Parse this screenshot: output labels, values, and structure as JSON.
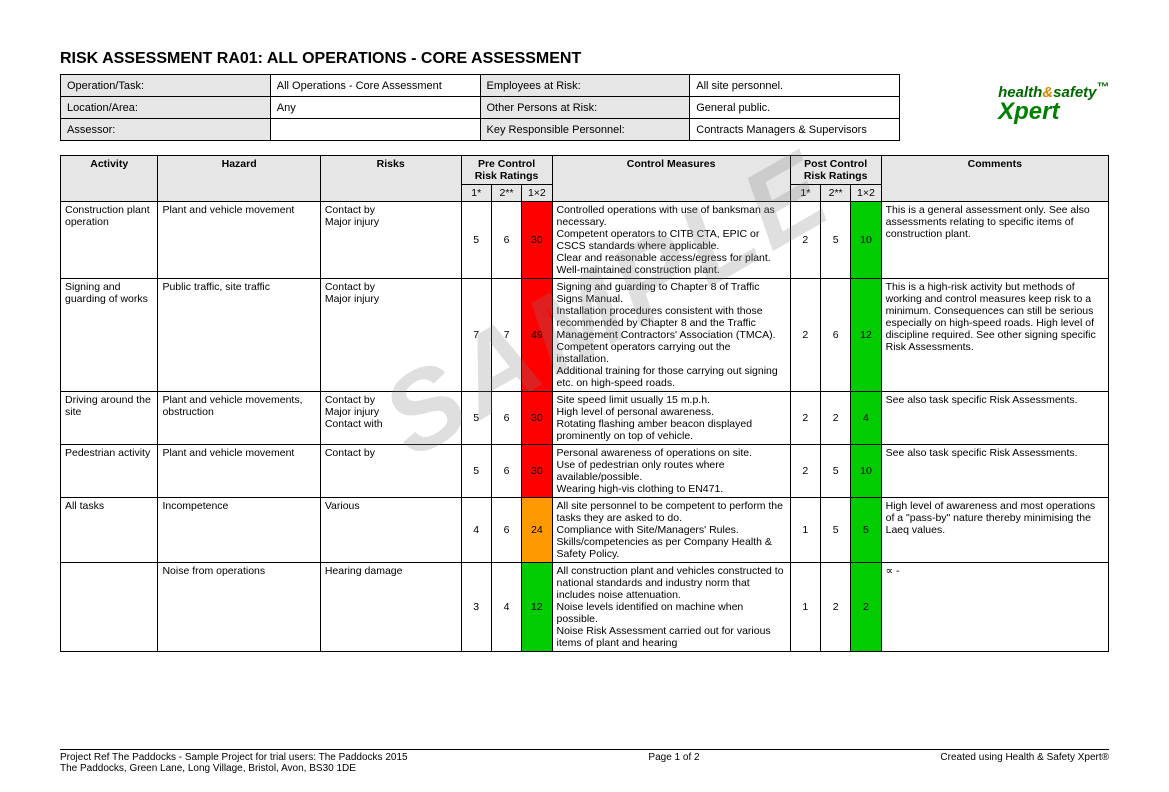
{
  "title": "RISK ASSESSMENT RA01: ALL OPERATIONS - CORE ASSESSMENT",
  "meta": {
    "operation_label": "Operation/Task:",
    "operation_val": "All Operations - Core Assessment",
    "employees_label": "Employees at Risk:",
    "employees_val": "All site personnel.",
    "location_label": "Location/Area:",
    "location_val": "Any",
    "others_label": "Other Persons at Risk:",
    "others_val": "General public.",
    "assessor_label": "Assessor:",
    "assessor_val": "",
    "key_label": "Key Responsible Personnel:",
    "key_val": "Contracts Managers & Supervisors"
  },
  "logo": {
    "top1": "health",
    "amp": "&",
    "top2": "safety",
    "bot": "Xpert"
  },
  "watermark": "SAMPLE",
  "headers": {
    "activity": "Activity",
    "hazard": "Hazard",
    "risks": "Risks",
    "pre": "Pre Control Risk Ratings",
    "post": "Post Control Risk Ratings",
    "cm": "Control Measures",
    "comments": "Comments",
    "c1": "1*",
    "c2": "2**",
    "c3": "1×2"
  },
  "rows": [
    {
      "activity": "Construction plant operation",
      "hazard": "Plant and vehicle movement",
      "risks": "Contact by\nMajor injury",
      "pre": {
        "p": "5",
        "s": "6",
        "r": "30",
        "cls": "risk-red"
      },
      "cm": "Controlled operations with use of banksman as necessary.\nCompetent operators to CITB CTA, EPIC or CSCS standards where applicable.\nClear and reasonable access/egress for plant.\nWell-maintained construction plant.",
      "post": {
        "p": "2",
        "s": "5",
        "r": "10",
        "cls": "risk-green"
      },
      "comments": "This is a general assessment only. See also assessments relating to specific items of construction plant."
    },
    {
      "activity": "Signing and guarding of works",
      "hazard": "Public traffic, site traffic",
      "risks": "Contact by\nMajor injury",
      "pre": {
        "p": "7",
        "s": "7",
        "r": "49",
        "cls": "risk-red"
      },
      "cm": "Signing and guarding to Chapter 8 of Traffic Signs Manual.\nInstallation procedures consistent with those recommended by Chapter 8 and the Traffic Management Contractors' Association (TMCA).\nCompetent operators carrying out the installation.\nAdditional training for those carrying out signing etc. on high-speed roads.",
      "post": {
        "p": "2",
        "s": "6",
        "r": "12",
        "cls": "risk-green"
      },
      "comments": "This is a high-risk activity but methods of working and control measures keep risk to a minimum. Consequences can still be serious especially on high-speed roads. High level of discipline required. See other signing specific Risk Assessments."
    },
    {
      "activity": "Driving around the site",
      "hazard": "Plant and vehicle movements, obstruction",
      "risks": "Contact by\nMajor injury\nContact with",
      "pre": {
        "p": "5",
        "s": "6",
        "r": "30",
        "cls": "risk-red"
      },
      "cm": "Site speed limit usually 15 m.p.h.\nHigh level of personal awareness.\nRotating flashing amber beacon displayed prominently on top of vehicle.",
      "post": {
        "p": "2",
        "s": "2",
        "r": "4",
        "cls": "risk-green"
      },
      "comments": "See also task specific Risk Assessments."
    },
    {
      "activity": "Pedestrian activity",
      "hazard": "Plant and vehicle movement",
      "risks": "Contact by",
      "pre": {
        "p": "5",
        "s": "6",
        "r": "30",
        "cls": "risk-red"
      },
      "cm": "Personal awareness of operations on site.\nUse of pedestrian only routes where available/possible.\nWearing high-vis clothing to EN471.",
      "post": {
        "p": "2",
        "s": "5",
        "r": "10",
        "cls": "risk-green"
      },
      "comments": "See also task specific Risk Assessments."
    },
    {
      "activity": "All tasks",
      "hazard": "Incompetence",
      "risks": "Various",
      "pre": {
        "p": "4",
        "s": "6",
        "r": "24",
        "cls": "risk-orange"
      },
      "cm": "All site personnel to be competent to perform the tasks they are asked to do.\nCompliance with Site/Managers' Rules.\nSkills/competencies as per Company Health & Safety Policy.",
      "post": {
        "p": "1",
        "s": "5",
        "r": "5",
        "cls": "risk-green"
      },
      "comments": "High level of awareness and most operations of a \"pass-by\" nature thereby minimising the Laeq values."
    },
    {
      "activity": "",
      "hazard": "Noise from operations",
      "risks": "Hearing damage",
      "pre": {
        "p": "3",
        "s": "4",
        "r": "12",
        "cls": "risk-green"
      },
      "cm": "All construction plant and vehicles constructed to national standards and industry norm that includes noise attenuation.\nNoise levels identified on machine when possible.\nNoise Risk Assessment carried out for various items of plant and hearing",
      "post": {
        "p": "1",
        "s": "2",
        "r": "2",
        "cls": "risk-green"
      },
      "comments": "     ∝     -"
    }
  ],
  "footer": {
    "left": "Project Ref The Paddocks - Sample Project for trial users: The Paddocks 2015\nThe Paddocks, Green Lane, Long Village, Bristol, Avon, BS30 1DE",
    "center": "Page 1 of 2",
    "right": "Created using Health & Safety Xpert®"
  }
}
